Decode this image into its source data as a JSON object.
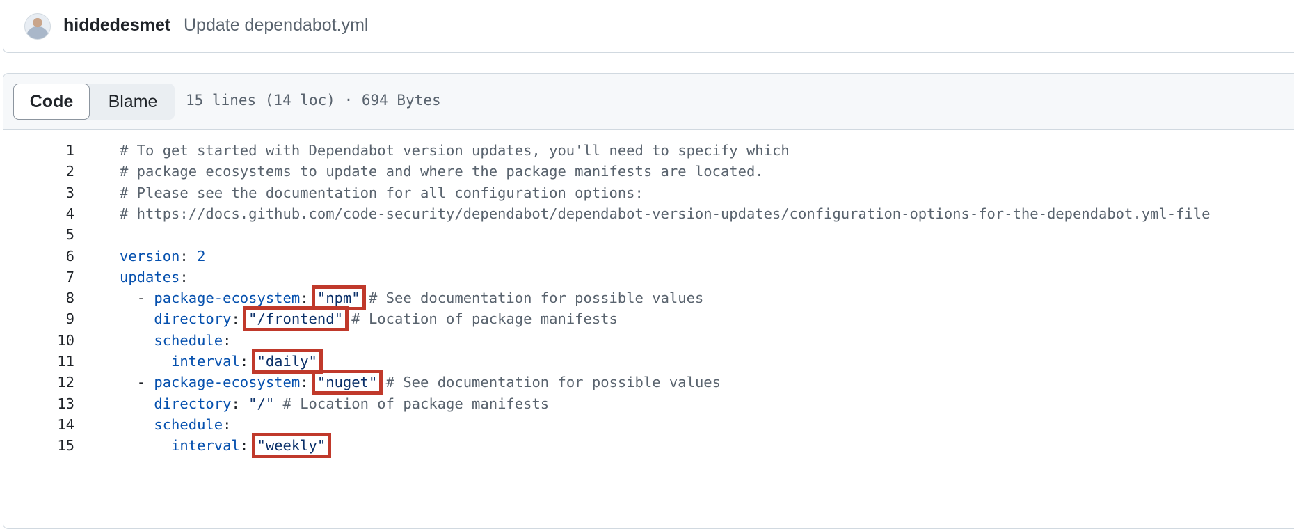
{
  "commit": {
    "author": "hiddedesmet",
    "message": "Update dependabot.yml"
  },
  "file_header": {
    "tabs": [
      {
        "label": "Code",
        "selected": true
      },
      {
        "label": "Blame",
        "selected": false
      }
    ],
    "meta": "15 lines (14 loc) · 694 Bytes"
  },
  "code": {
    "lines": [
      {
        "n": "1",
        "indent": "",
        "parts": [
          {
            "t": "# To get started with Dependabot version updates, you'll need to specify which",
            "c": "comment"
          }
        ]
      },
      {
        "n": "2",
        "indent": "",
        "parts": [
          {
            "t": "# package ecosystems to update and where the package manifests are located.",
            "c": "comment"
          }
        ]
      },
      {
        "n": "3",
        "indent": "",
        "parts": [
          {
            "t": "# Please see the documentation for all configuration options:",
            "c": "comment"
          }
        ]
      },
      {
        "n": "4",
        "indent": "",
        "parts": [
          {
            "t": "# https://docs.github.com/code-security/dependabot/dependabot-version-updates/configuration-options-for-the-dependabot.yml-file",
            "c": "comment"
          }
        ]
      },
      {
        "n": "5",
        "indent": "",
        "parts": []
      },
      {
        "n": "6",
        "indent": "",
        "parts": [
          {
            "t": "version",
            "c": "key"
          },
          {
            "t": ": ",
            "c": "plain"
          },
          {
            "t": "2",
            "c": "num"
          }
        ]
      },
      {
        "n": "7",
        "indent": "",
        "parts": [
          {
            "t": "updates",
            "c": "key"
          },
          {
            "t": ":",
            "c": "plain"
          }
        ]
      },
      {
        "n": "8",
        "indent": "  ",
        "parts": [
          {
            "t": "- ",
            "c": "plain"
          },
          {
            "t": "package-ecosystem",
            "c": "key"
          },
          {
            "t": ": ",
            "c": "plain"
          },
          {
            "t": "\"npm\"",
            "c": "str"
          },
          {
            "t": " # See documentation for possible values",
            "c": "comment"
          }
        ]
      },
      {
        "n": "9",
        "indent": "    ",
        "parts": [
          {
            "t": "directory",
            "c": "key"
          },
          {
            "t": ": ",
            "c": "plain"
          },
          {
            "t": "\"/frontend\"",
            "c": "str"
          },
          {
            "t": " # Location of package manifests",
            "c": "comment"
          }
        ]
      },
      {
        "n": "10",
        "indent": "    ",
        "parts": [
          {
            "t": "schedule",
            "c": "key"
          },
          {
            "t": ":",
            "c": "plain"
          }
        ]
      },
      {
        "n": "11",
        "indent": "      ",
        "parts": [
          {
            "t": "interval",
            "c": "key"
          },
          {
            "t": ": ",
            "c": "plain"
          },
          {
            "t": "\"daily\"",
            "c": "str"
          }
        ]
      },
      {
        "n": "12",
        "indent": "  ",
        "parts": [
          {
            "t": "- ",
            "c": "plain"
          },
          {
            "t": "package-ecosystem",
            "c": "key"
          },
          {
            "t": ": ",
            "c": "plain"
          },
          {
            "t": "\"nuget\"",
            "c": "str"
          },
          {
            "t": " # See documentation for possible values",
            "c": "comment"
          }
        ]
      },
      {
        "n": "13",
        "indent": "    ",
        "parts": [
          {
            "t": "directory",
            "c": "key"
          },
          {
            "t": ": ",
            "c": "plain"
          },
          {
            "t": "\"/\"",
            "c": "str"
          },
          {
            "t": " # Location of package manifests",
            "c": "comment"
          }
        ]
      },
      {
        "n": "14",
        "indent": "    ",
        "parts": [
          {
            "t": "schedule",
            "c": "key"
          },
          {
            "t": ":",
            "c": "plain"
          }
        ]
      },
      {
        "n": "15",
        "indent": "      ",
        "parts": [
          {
            "t": "interval",
            "c": "key"
          },
          {
            "t": ": ",
            "c": "plain"
          },
          {
            "t": "\"weekly\"",
            "c": "str"
          }
        ]
      }
    ],
    "highlighted_values": [
      "\"npm\"",
      "\"/frontend\"",
      "\"daily\"",
      "\"nuget\"",
      "\"weekly\""
    ]
  },
  "colors": {
    "highlight_border": "#c0392b",
    "comment": "#59636e",
    "key": "#0550ae",
    "string": "#0a3069"
  }
}
